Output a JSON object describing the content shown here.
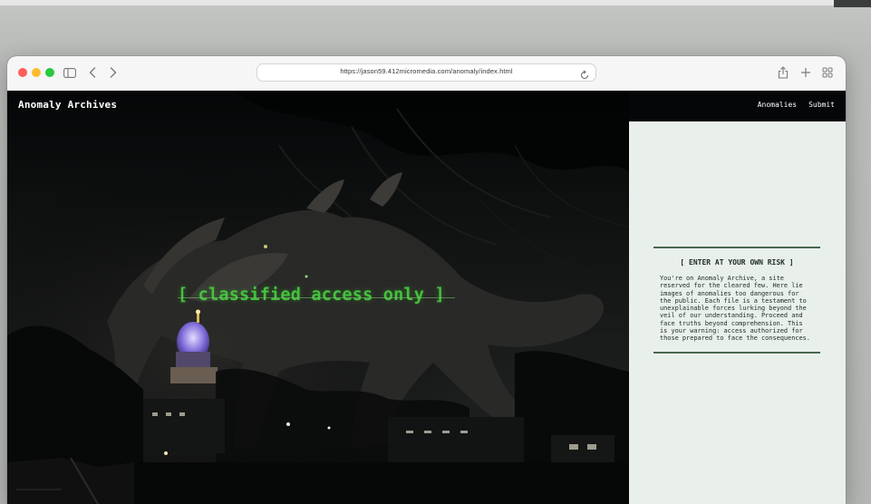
{
  "browser": {
    "url": "https://jason59.412micromedia.com/anomaly/index.html",
    "traffic_lights": {
      "close": "#fe5f57",
      "minimize": "#febc2e",
      "zoom": "#28c840"
    },
    "icons": [
      "sidebar-icon",
      "back-icon",
      "forward-icon",
      "reload-icon",
      "share-icon",
      "new-tab-icon",
      "tab-overview-icon"
    ]
  },
  "site": {
    "title": "Anomaly Archives",
    "nav": [
      "Anomalies",
      "Submit"
    ]
  },
  "hero": {
    "overlay_text": "[ classified access only ]",
    "accent_color": "#44c23c"
  },
  "panel": {
    "heading": "[ ENTER AT YOUR OWN RISK ]",
    "body": "You're on Anomaly Archive, a site reserved for the cleared few. Here lie images of anomalies too dangerous for the public. Each file is a testament to unexplainable forces lurking beyond the veil of our understanding. Proceed and face truths beyond comprehension. This is your warning: access authorized for those prepared to face the consequences.",
    "background": "#e9f0ec",
    "rule_color": "#47674f"
  }
}
